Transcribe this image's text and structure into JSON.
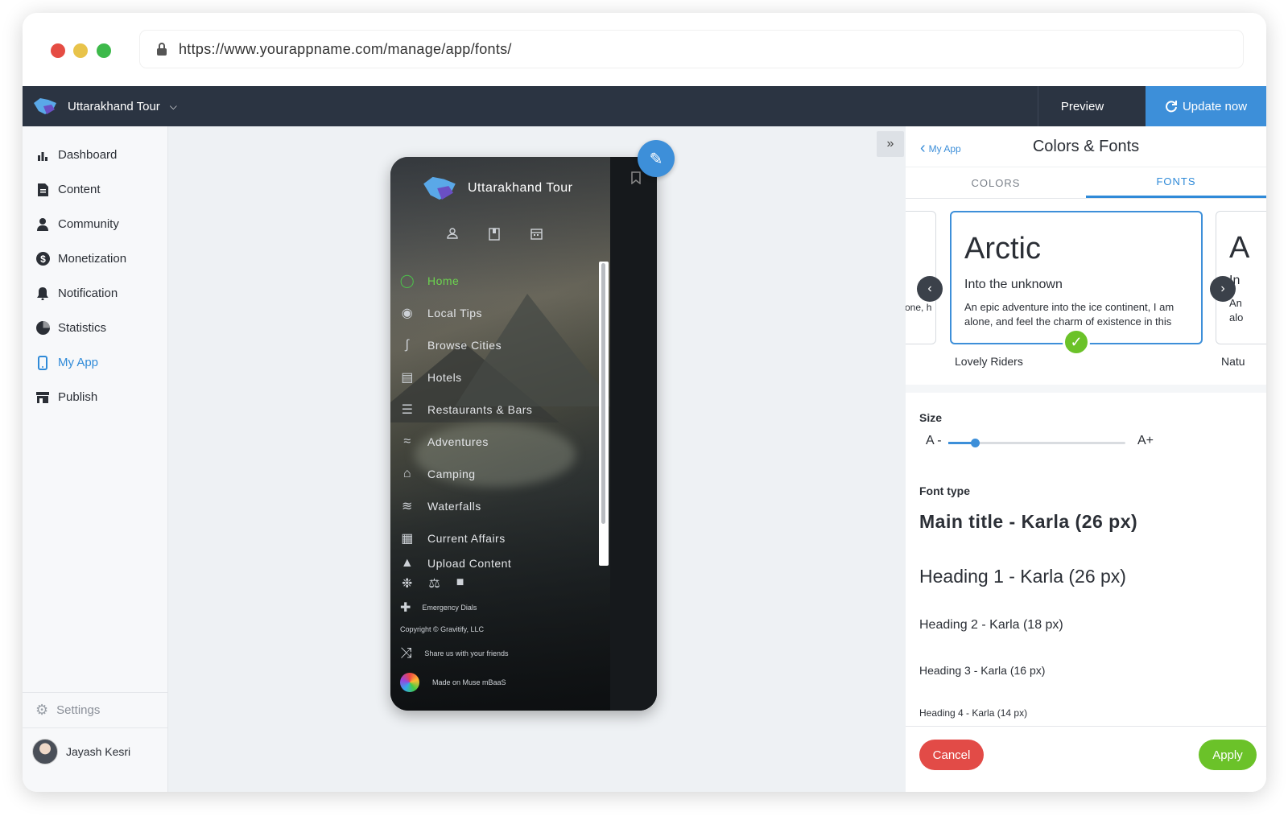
{
  "browser": {
    "url": "https://www.yourappname.com/manage/app/fonts/",
    "traffic_lights": [
      "#e54c43",
      "#e8c34a",
      "#3db94a"
    ]
  },
  "topnav": {
    "app_name": "Uttarakhand Tour",
    "preview_label": "Preview",
    "update_label": "Update now"
  },
  "sidebar": {
    "items": [
      {
        "label": "Dashboard",
        "icon": "bar-chart-icon"
      },
      {
        "label": "Content",
        "icon": "document-icon"
      },
      {
        "label": "Community",
        "icon": "person-icon"
      },
      {
        "label": "Monetization",
        "icon": "dollar-icon"
      },
      {
        "label": "Notification",
        "icon": "bell-icon"
      },
      {
        "label": "Statistics",
        "icon": "pie-chart-icon"
      },
      {
        "label": "My App",
        "icon": "phone-icon"
      },
      {
        "label": "Publish",
        "icon": "store-icon"
      }
    ],
    "active": "My App",
    "settings_label": "Settings",
    "user_name": "Jayash Kesri"
  },
  "phone": {
    "title": "Uttarakhand Tour",
    "menu": [
      {
        "label": "Home",
        "icon": "circle-icon"
      },
      {
        "label": "Local Tips",
        "icon": "location-pin-icon"
      },
      {
        "label": "Browse Cities",
        "icon": "route-icon"
      },
      {
        "label": "Hotels",
        "icon": "bed-icon"
      },
      {
        "label": "Restaurants & Bars",
        "icon": "food-icon"
      },
      {
        "label": "Adventures",
        "icon": "swim-icon"
      },
      {
        "label": "Camping",
        "icon": "building-icon"
      },
      {
        "label": "Waterfalls",
        "icon": "waves-icon"
      },
      {
        "label": "Current Affairs",
        "icon": "table-icon"
      },
      {
        "label": "Upload Content",
        "icon": "upload-icon"
      }
    ],
    "emergency_label": "Emergency Dials",
    "copyright": "Copyright © Gravitify, LLC",
    "share_label": "Share us with your friends",
    "made_on": "Made on Muse mBaaS"
  },
  "panel": {
    "back_label": "My App",
    "title": "Colors & Fonts",
    "tabs": [
      {
        "label": "COLORS"
      },
      {
        "label": "FONTS"
      }
    ],
    "active_tab": "FONTS",
    "font_card": {
      "title": "Arctic",
      "subtitle": "Into the unknown",
      "body": "An epic adventure into the ice continent, I am alone, and feel the charm of existence in this spot, which was created for the bliss of souls like mine.",
      "name": "Lovely Riders"
    },
    "prev_card_snippet": "one, h",
    "next_card": {
      "title": "A",
      "subtitle": "In",
      "body": "An alo",
      "name": "Natu"
    },
    "size_label": "Size",
    "size_min": "A -",
    "size_max": "A+",
    "size_value_fraction": 0.15,
    "font_type_label": "Font type",
    "font_types": [
      {
        "label": "Main title - Karla (26 px)"
      },
      {
        "label": "Heading 1 - Karla (26 px)"
      },
      {
        "label": "Heading 2 - Karla (18 px)"
      },
      {
        "label": "Heading 3 - Karla (16 px)"
      },
      {
        "label": "Heading 4 - Karla (14 px)"
      }
    ],
    "cancel_label": "Cancel",
    "apply_label": "Apply"
  },
  "colors": {
    "accent": "#3d8fd9",
    "nav": "#2b3442",
    "success": "#6bc229",
    "danger": "#e24b47"
  }
}
